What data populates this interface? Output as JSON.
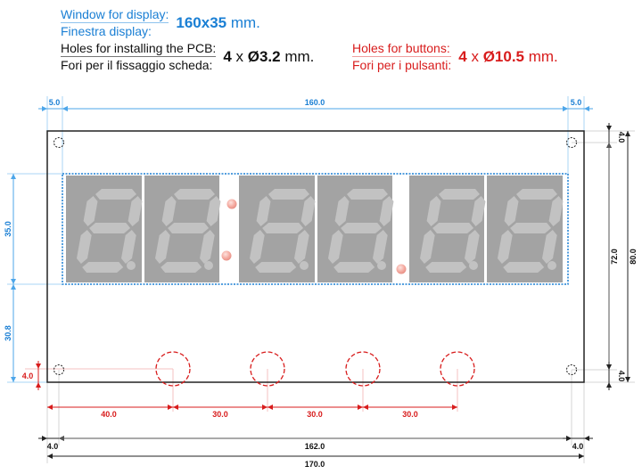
{
  "header": {
    "window": {
      "label_en": "Window for display:",
      "label_it": "Finestra display:",
      "value_bold": "160x35",
      "value_unit": " mm."
    },
    "pcb_holes": {
      "label_en": "Holes for installing the PCB:",
      "label_it": "Fori per il fissaggio scheda:",
      "count": "4",
      "times": " x ",
      "diameter_bold": "Ø3.2",
      "value_unit": " mm."
    },
    "button_holes": {
      "label_en": "Holes for buttons:",
      "label_it": "Fori per i pulsanti:",
      "count": "4",
      "times": " x ",
      "diameter_bold": "Ø10.5",
      "value_unit": " mm."
    }
  },
  "colors": {
    "window_blue": "#1a7fd4",
    "button_red": "#d81c1c",
    "outline_black": "#111111",
    "digit_panel_gray": "#a3a3a3",
    "segment_gray": "#c2c2c2",
    "led_dot": "#f0a8a0"
  },
  "drawing": {
    "board_width_mm": 170,
    "board_height_mm": 80,
    "digits_count": 6,
    "dims": {
      "top_left_margin": "5.0",
      "window_width": "160.0",
      "top_right_margin": "5.0",
      "window_height": "35.0",
      "window_bottom_offset": "30.8",
      "button_hole_offset": "4.0",
      "right_top_hole": "4.0",
      "right_hole_span": "72.0",
      "right_board_height": "80.0",
      "right_bottom_hole": "4.0",
      "button_first": "40.0",
      "button_pitch_1": "30.0",
      "button_pitch_2": "30.0",
      "button_pitch_3": "30.0",
      "bottom_left_hole": "4.0",
      "bottom_hole_span": "162.0",
      "bottom_right_hole": "4.0",
      "board_width": "170.0"
    }
  }
}
